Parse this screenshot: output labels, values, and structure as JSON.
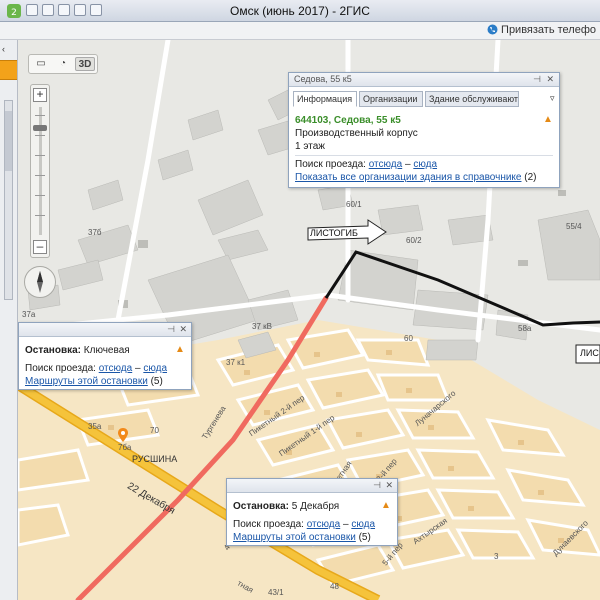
{
  "window": {
    "title": "Омск (июнь 2017) - 2ГИС",
    "attach_phone_label": "Привязать телефо"
  },
  "map_controls": {
    "mode_3d_label": "3D",
    "zoom_in": "+",
    "zoom_out": "–"
  },
  "map_labels": {
    "house_numbers": [
      "60/1",
      "60/2",
      "55/4",
      "58а",
      "60",
      "37б",
      "37а",
      "37 кВ",
      "37 к1",
      "35а",
      "70",
      "7ба",
      "48",
      "43/1",
      "3"
    ],
    "district": "РУСШИНА",
    "streets": {
      "turgeneva": "Тургенева",
      "dekabrya22": "22 Декабря",
      "piketny2": "Пикетный 2-й пер",
      "piketny1": "Пикетный 1-й пер",
      "piketnaya": "Пикетная",
      "lunacharskogo": "Луначарского",
      "per2": "2-й пер",
      "per5": "5-й пер",
      "ahtyrskaya": "Ахтырская",
      "dunaevskogo": "Дунаевского",
      "tnaya": "тная",
      "per4": "4-й пер"
    },
    "callout_listogib_1": "ЛИСТОГИБ",
    "callout_listogib_2": "ЛИС"
  },
  "info_card": {
    "header": "Седова, 55 к5",
    "tabs": [
      "Информация",
      "Организации",
      "Здание обслуживают"
    ],
    "address": "644103, Седова, 55 к5",
    "building_type": "Производственный корпус",
    "floors": "1 этаж",
    "route_prefix": "Поиск проезда:",
    "route_from": "отсюда",
    "route_dash": "–",
    "route_to": "сюда",
    "all_orgs_link": "Показать все организации здания в справочнике",
    "all_orgs_count": "(2)"
  },
  "stop_card_1": {
    "title_prefix": "Остановка:",
    "title_name": "Ключевая",
    "route_prefix": "Поиск проезда:",
    "route_from": "отсюда",
    "route_dash": "–",
    "route_to": "сюда",
    "routes_link": "Маршруты этой остановки",
    "routes_count": "(5)"
  },
  "stop_card_2": {
    "title_prefix": "Остановка:",
    "title_name": "5 Декабря",
    "route_prefix": "Поиск проезда:",
    "route_from": "отсюда",
    "route_dash": "–",
    "route_to": "сюда",
    "routes_link": "Маршруты этой остановки",
    "routes_count": "(5)"
  },
  "colors": {
    "accent_orange": "#f3a21a",
    "route_red": "#f06a5f",
    "route_black": "#111111",
    "road_yellow": "#f2b21c",
    "residential": "#f6e6c4",
    "industrial": "#d9d9d9",
    "link_blue": "#1a56a8",
    "address_green": "#3a8e2a"
  },
  "icons": {
    "app": "2gis-app-icon",
    "phone": "phone-icon",
    "compass": "compass-icon",
    "pin": "bus-stop-pin-icon",
    "warning": "warning-triangle-icon",
    "pin_window": "pin-window-icon",
    "close": "close-icon"
  }
}
